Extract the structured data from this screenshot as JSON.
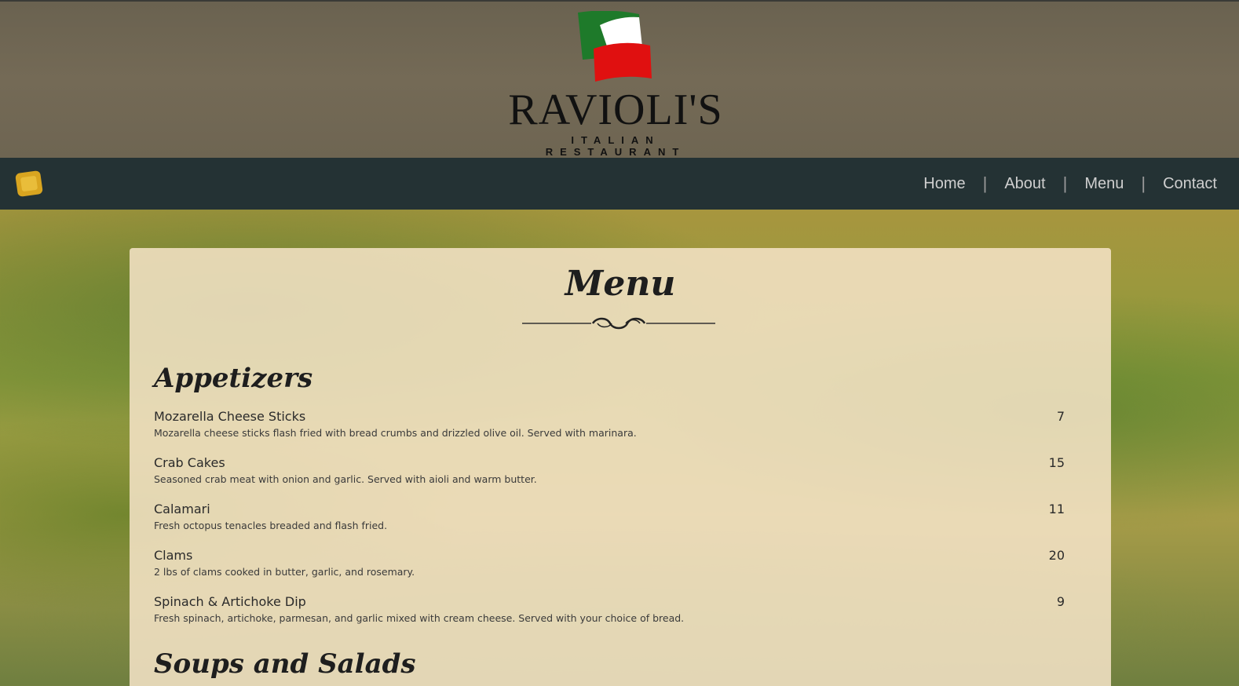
{
  "header": {
    "brand_name": "RAVIOLI'S",
    "tagline": "ITALIAN RESTAURANT"
  },
  "nav": {
    "items": [
      {
        "label": "Home"
      },
      {
        "label": "About"
      },
      {
        "label": "Menu"
      },
      {
        "label": "Contact"
      }
    ],
    "separator": "|"
  },
  "menu": {
    "title": "Menu",
    "sections": [
      {
        "title": "Appetizers",
        "items": [
          {
            "name": "Mozarella Cheese Sticks",
            "price": "7",
            "description": "Mozarella cheese sticks flash fried with bread crumbs and drizzled olive oil. Served with marinara."
          },
          {
            "name": "Crab Cakes",
            "price": "15",
            "description": "Seasoned crab meat with onion and garlic. Served with aioli and warm butter."
          },
          {
            "name": "Calamari",
            "price": "11",
            "description": "Fresh octopus tenacles breaded and flash fried."
          },
          {
            "name": "Clams",
            "price": "20",
            "description": "2 lbs of clams cooked in butter, garlic, and rosemary."
          },
          {
            "name": "Spinach & Artichoke Dip",
            "price": "9",
            "description": "Fresh spinach, artichoke, parmesan, and garlic mixed with cream cheese. Served with your choice of bread."
          }
        ]
      },
      {
        "title": "Soups and Salads",
        "items": []
      }
    ]
  },
  "colors": {
    "navbar": "#243234",
    "card": "#f6e4c8",
    "flag_green": "#1e7a2a",
    "flag_red": "#e01010"
  }
}
